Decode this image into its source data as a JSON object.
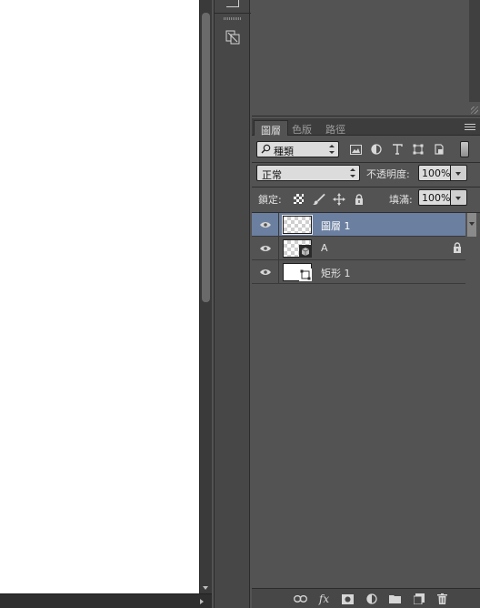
{
  "layers_panel": {
    "tabs": [
      {
        "label": "圖層",
        "active": true
      },
      {
        "label": "色版",
        "active": false
      },
      {
        "label": "路徑",
        "active": false
      }
    ],
    "filter": {
      "kind_label": "種類",
      "filter_icons": [
        "image-filter-icon",
        "adjustment-filter-icon",
        "type-filter-icon",
        "shape-filter-icon",
        "smart-object-filter-icon"
      ]
    },
    "blend_mode": "正常",
    "opacity_label": "不透明度:",
    "opacity_value": "100%",
    "lock_label": "鎖定:",
    "fill_label": "填滿:",
    "fill_value": "100%",
    "layers": [
      {
        "name": "圖層 1",
        "selected": true,
        "visible": true,
        "thumb": "checker",
        "badge": "none",
        "locked": false
      },
      {
        "name": "A",
        "selected": false,
        "visible": true,
        "thumb": "checker",
        "badge": "smart-object-icon",
        "locked": true
      },
      {
        "name": "矩形 1",
        "selected": false,
        "visible": true,
        "thumb": "white",
        "badge": "shape-icon",
        "locked": false
      }
    ],
    "bottom_icons": [
      "link-layers-icon",
      "fx-icon",
      "layer-mask-icon",
      "adjustment-layer-icon",
      "group-folder-icon",
      "new-layer-icon",
      "trash-icon"
    ],
    "fx_label": "fx"
  },
  "colors": {
    "panel_bg": "#535353",
    "selected_layer": "#6b7fa0",
    "canvas": "#ffffff"
  }
}
